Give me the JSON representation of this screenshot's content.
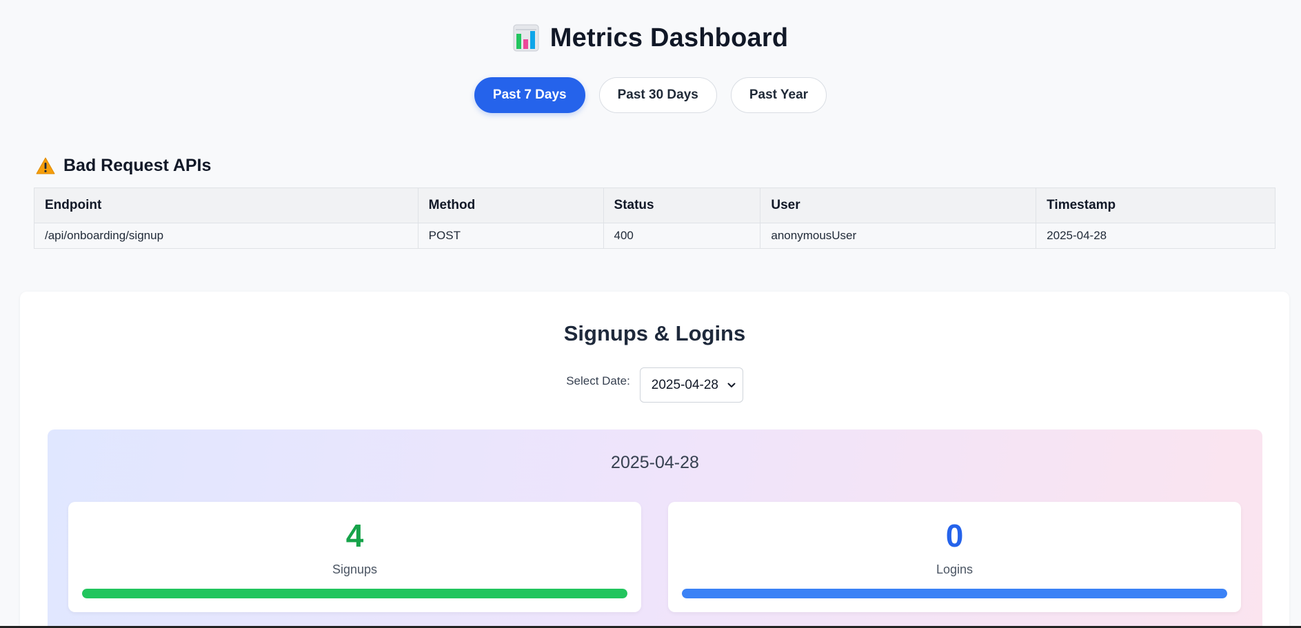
{
  "header": {
    "title": "Metrics Dashboard",
    "icon": "bar-chart-icon"
  },
  "range_tabs": [
    {
      "label": "Past 7 Days",
      "active": true
    },
    {
      "label": "Past 30 Days",
      "active": false
    },
    {
      "label": "Past Year",
      "active": false
    }
  ],
  "bad_requests": {
    "heading": "Bad Request APIs",
    "icon": "warning-icon",
    "columns": [
      "Endpoint",
      "Method",
      "Status",
      "User",
      "Timestamp"
    ],
    "rows": [
      [
        "/api/onboarding/signup",
        "POST",
        "400",
        "anonymousUser",
        "2025-04-28"
      ]
    ]
  },
  "signups_logins": {
    "title": "Signups & Logins",
    "select_label": "Select Date:",
    "selected_date": "2025-04-28",
    "panel_date": "2025-04-28",
    "signups": {
      "value": "4",
      "label": "Signups",
      "color": "#16a34a",
      "bar_color": "#22c55e",
      "fill_percent": 100
    },
    "logins": {
      "value": "0",
      "label": "Logins",
      "color": "#2563eb",
      "bar_color": "#3b82f6",
      "fill_percent": 100
    }
  }
}
